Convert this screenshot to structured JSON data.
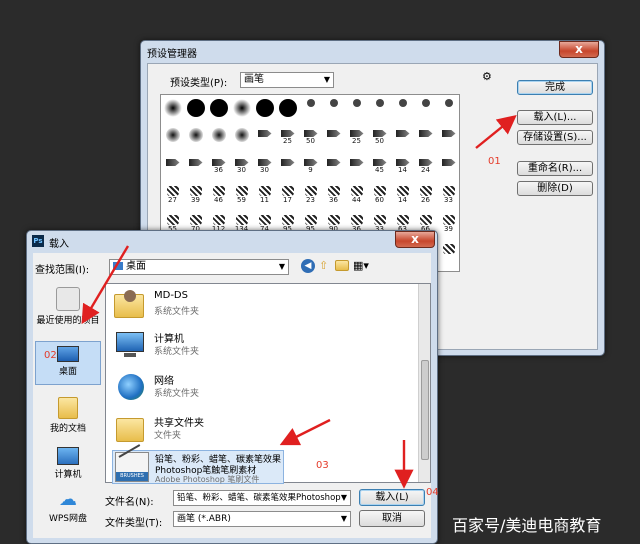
{
  "preset_manager": {
    "title": "预设管理器",
    "close_label": "x",
    "preset_type_label": "预设类型(P):",
    "preset_type_value": "画笔",
    "buttons": {
      "done": "完成",
      "load": "载入(L)...",
      "save_set": "存储设置(S)...",
      "rename": "重命名(R)...",
      "delete": "删除(D)"
    },
    "brush_rows": [
      [
        "",
        "",
        "",
        "",
        "",
        "",
        "",
        "",
        "",
        "",
        "",
        "",
        ""
      ],
      [
        "",
        "",
        "",
        "",
        "",
        "25",
        "50",
        "",
        "25",
        "50",
        "",
        "",
        ""
      ],
      [
        "",
        "",
        "36",
        "30",
        "30",
        "",
        "9",
        "",
        "",
        "45",
        "14",
        "24",
        ""
      ],
      [
        "27",
        "39",
        "46",
        "59",
        "11",
        "17",
        "23",
        "36",
        "44",
        "60",
        "14",
        "26",
        "33"
      ],
      [
        "55",
        "70",
        "112",
        "134",
        "74",
        "95",
        "95",
        "90",
        "36",
        "33",
        "63",
        "66",
        "39"
      ],
      [
        "",
        "",
        "",
        "",
        "",
        "100",
        "",
        "",
        "",
        "",
        "",
        "",
        ""
      ]
    ]
  },
  "load_dialog": {
    "title": "载入",
    "look_in_label": "查找范围(I):",
    "look_in_value": "桌面",
    "places": [
      {
        "label": "最近使用的项目",
        "icon": "recent-icon"
      },
      {
        "label": "桌面",
        "icon": "desktop-icon"
      },
      {
        "label": "我的文档",
        "icon": "documents-icon"
      },
      {
        "label": "计算机",
        "icon": "computer-icon"
      },
      {
        "label": "WPS网盘",
        "icon": "cloud-icon"
      }
    ],
    "files": [
      {
        "name": "MD-DS",
        "type": "系统文件夹",
        "icon": "user-folder-icon"
      },
      {
        "name": "计算机",
        "type": "系统文件夹",
        "icon": "computer-icon"
      },
      {
        "name": "网络",
        "type": "系统文件夹",
        "icon": "network-icon"
      },
      {
        "name": "共享文件夹",
        "type": "文件夹",
        "icon": "folder-icon"
      },
      {
        "name_line1": "铅笔、粉彩、蜡笔、碳素笔效果",
        "name_line2": "Photoshop笔触笔刷素材",
        "type": "Adobe Photoshop 笔刷文件",
        "icon": "brushes-file-icon",
        "icon_text": "BRUSHES"
      }
    ],
    "file_name_label": "文件名(N):",
    "file_name_value": "铅笔、粉彩、蜡笔、碳素笔效果Photoshop",
    "file_type_label": "文件类型(T):",
    "file_type_value": "画笔 (*.ABR)",
    "load_button": "载入(L)",
    "cancel_button": "取消"
  },
  "annotations": {
    "step1": "01",
    "step2": "02",
    "step3": "03",
    "step4": "04"
  },
  "watermark": "百家号/美迪电商教育",
  "colors": {
    "arrow": "#e02020",
    "window_frame": "#cfdcec"
  }
}
